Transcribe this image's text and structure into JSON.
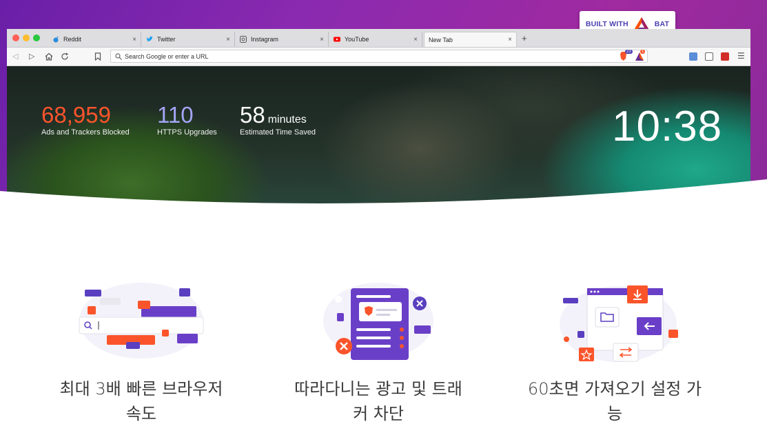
{
  "badge": {
    "prefix": "BUILT WITH",
    "suffix": "BAT"
  },
  "browser": {
    "tabs": [
      {
        "label": "Reddit",
        "icon": "reddit-icon",
        "close": "×",
        "active": false
      },
      {
        "label": "Twitter",
        "icon": "twitter-icon",
        "close": "×",
        "active": false
      },
      {
        "label": "Instagram",
        "icon": "instagram-icon",
        "close": "×",
        "active": false
      },
      {
        "label": "YouTube",
        "icon": "youtube-icon",
        "close": "×",
        "active": false
      },
      {
        "label": "New Tab",
        "icon": "",
        "close": "×",
        "active": true
      }
    ],
    "new_tab": "+",
    "url_placeholder": "Search Google or enter a URL",
    "shields_count": "23",
    "rewards_count": "1"
  },
  "stats": {
    "ads_blocked": {
      "value": "68,959",
      "label": "Ads and Trackers Blocked",
      "color": "#fb542b"
    },
    "https_upgrades": {
      "value": "110",
      "label": "HTTPS Upgrades",
      "color": "#a3a5f5"
    },
    "time_saved": {
      "value": "58",
      "unit": "minutes",
      "label": "Estimated Time Saved",
      "color": "#ffffff"
    }
  },
  "clock": "10:38",
  "features": [
    {
      "text": "최대 3배 빠른 브라우저 속도",
      "icon": "speed-illustration-icon"
    },
    {
      "text": "따라다니는 광고 및 트래커 차단",
      "icon": "ad-blocking-illustration-icon"
    },
    {
      "text": "60초면 가져오기 설정 가능",
      "icon": "import-settings-illustration-icon"
    }
  ],
  "colors": {
    "brand_orange": "#fb542b",
    "brand_purple": "#6a1fa8",
    "bat_purple": "#4a3fb0"
  }
}
